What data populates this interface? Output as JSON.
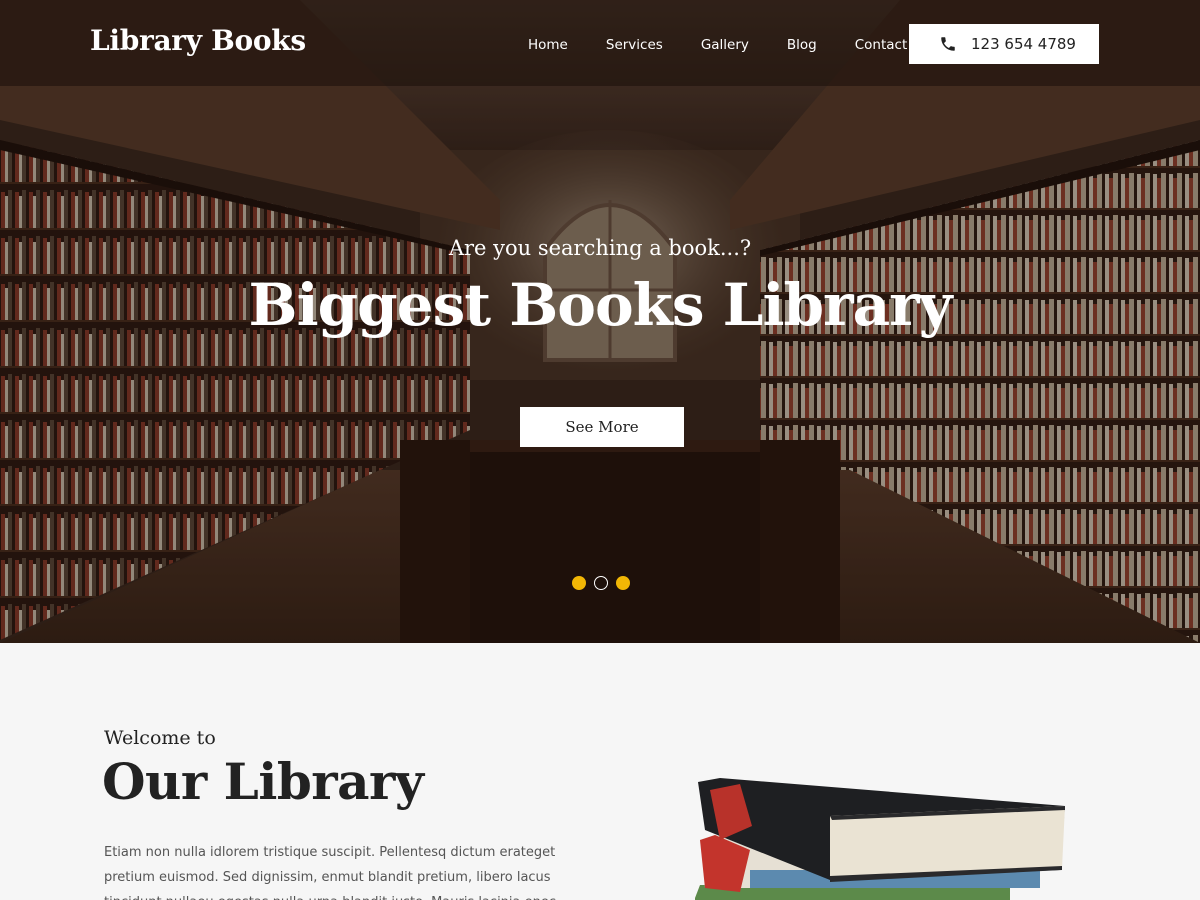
{
  "header": {
    "logo": "Library Books",
    "nav": [
      "Home",
      "Services",
      "Gallery",
      "Blog",
      "Contact"
    ],
    "phone": "123 654 4789",
    "phone_icon": "phone-icon"
  },
  "hero": {
    "subtitle": "Are you searching a book...?",
    "title": "Biggest Books Library",
    "button_label": "See More",
    "slides": {
      "count": 3,
      "active": 2
    },
    "accent_color": "#f2b705"
  },
  "welcome": {
    "small": "Welcome to",
    "big_regular": "Our ",
    "big_bold": "Library",
    "text": "Etiam non nulla idlorem tristique suscipit. Pellentesq dictum erateget pretium euismod. Sed dignissim, enmut blandit pretium, libero lacus tincidunt nullaeu egestas nulla urna blandit justo. Mauris lacinia enec aliquam mollis. Phasellus"
  }
}
